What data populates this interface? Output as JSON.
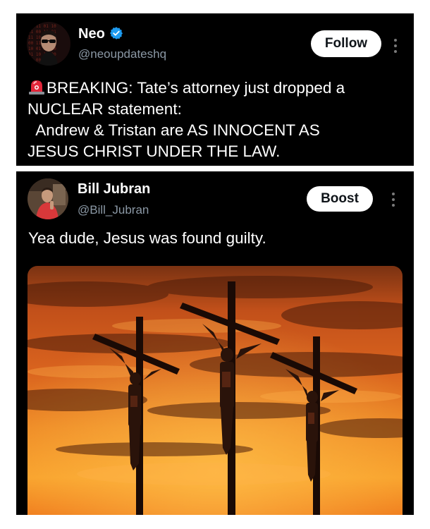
{
  "tweet1": {
    "author_name": "Neo",
    "handle": "@neoupdateshq",
    "verified": true,
    "follow_label": "Follow",
    "text_lines": [
      "BREAKING: Tate’s attorney just dropped a",
      "NUCLEAR statement:",
      "  Andrew & Tristan are AS INNOCENT AS",
      "JESUS CHRIST UNDER THE LAW."
    ],
    "leading_icon": "siren-emoji-icon"
  },
  "tweet2": {
    "author_name": "Bill Jubran",
    "handle": "@Bill_Jubran",
    "boost_label": "Boost",
    "text": "Yea dude, Jesus was found guilty.",
    "image_description": "three-crosses-sunset-image"
  },
  "colors": {
    "card_bg": "#000000",
    "handle_gray": "#8b98a5",
    "verified_blue": "#1d9bf0",
    "button_bg": "#ffffff",
    "sky_orange": "#e8631a"
  }
}
